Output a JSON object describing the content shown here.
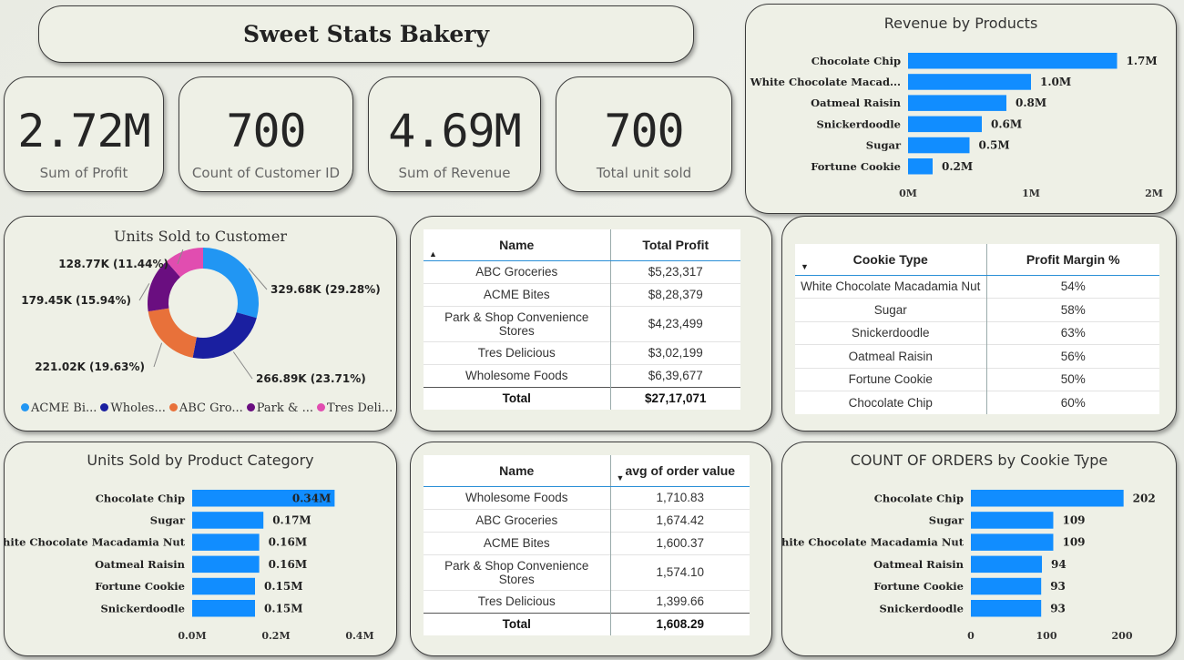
{
  "title": "Sweet Stats Bakery",
  "kpis": [
    {
      "value": "2.72M",
      "label": "Sum of Profit"
    },
    {
      "value": "700",
      "label": "Count of Customer ID"
    },
    {
      "value": "4.69M",
      "label": "Sum of Revenue"
    },
    {
      "value": "700",
      "label": "Total unit sold"
    }
  ],
  "colors": {
    "bar": "#118DFF",
    "donut": [
      "#2196F3",
      "#1A1FA0",
      "#E8713A",
      "#6A0E80",
      "#E14DB0"
    ]
  },
  "revenue_chart": {
    "title": "Revenue by Products",
    "chart_data": {
      "type": "bar",
      "categories": [
        "Chocolate Chip",
        "White Chocolate Macad...",
        "Oatmeal Raisin",
        "Snickerdoodle",
        "Sugar",
        "Fortune Cookie"
      ],
      "values": [
        1.7,
        1.0,
        0.8,
        0.6,
        0.5,
        0.2
      ],
      "data_labels": [
        "1.7M",
        "1.0M",
        "0.8M",
        "0.6M",
        "0.5M",
        "0.2M"
      ],
      "xlim": [
        0,
        2
      ],
      "ticks": [
        "0M",
        "1M",
        "2M"
      ]
    }
  },
  "donut_chart": {
    "title": "Units Sold to Customer",
    "chart_data": {
      "type": "pie",
      "categories": [
        "ACME Bites",
        "Wholesome Foods",
        "ABC Groceries",
        "Park & Shop Convenience Stores",
        "Tres Delicious"
      ],
      "values": [
        329.68,
        266.89,
        221.02,
        179.45,
        128.77
      ],
      "data_labels": [
        "329.68K (29.28%)",
        "266.89K (23.71%)",
        "221.02K (19.63%)",
        "179.45K (15.94%)",
        "128.77K (11.44%)"
      ],
      "legend": [
        "ACME Bi...",
        "Wholes...",
        "ABC Gro...",
        "Park & ...",
        "Tres Deli..."
      ]
    }
  },
  "profit_table": {
    "headers": [
      "Name",
      "Total Profit"
    ],
    "rows": [
      [
        "ABC Groceries",
        "$5,23,317"
      ],
      [
        "ACME Bites",
        "$8,28,379"
      ],
      [
        "Park & Shop Convenience Stores",
        "$4,23,499"
      ],
      [
        "Tres Delicious",
        "$3,02,199"
      ],
      [
        "Wholesome Foods",
        "$6,39,677"
      ]
    ],
    "total": [
      "Total",
      "$27,17,071"
    ]
  },
  "margin_table": {
    "headers": [
      "Cookie Type",
      "Profit Margin %"
    ],
    "rows": [
      [
        "White Chocolate Macadamia Nut",
        "54%"
      ],
      [
        "Sugar",
        "58%"
      ],
      [
        "Snickerdoodle",
        "63%"
      ],
      [
        "Oatmeal Raisin",
        "56%"
      ],
      [
        "Fortune Cookie",
        "50%"
      ],
      [
        "Chocolate Chip",
        "60%"
      ]
    ]
  },
  "category_chart": {
    "title": "Units Sold by Product Category",
    "chart_data": {
      "type": "bar",
      "categories": [
        "Chocolate Chip",
        "Sugar",
        "White Chocolate Macadamia Nut",
        "Oatmeal Raisin",
        "Fortune Cookie",
        "Snickerdoodle"
      ],
      "values": [
        0.34,
        0.17,
        0.16,
        0.16,
        0.15,
        0.15
      ],
      "data_labels": [
        "0.34M",
        "0.17M",
        "0.16M",
        "0.16M",
        "0.15M",
        "0.15M"
      ],
      "xlim": [
        0,
        0.4
      ],
      "ticks": [
        "0.0M",
        "0.2M",
        "0.4M"
      ]
    }
  },
  "order_table": {
    "headers": [
      "Name",
      "avg of order value"
    ],
    "rows": [
      [
        "Wholesome Foods",
        "1,710.83"
      ],
      [
        "ABC Groceries",
        "1,674.42"
      ],
      [
        "ACME Bites",
        "1,600.37"
      ],
      [
        "Park & Shop Convenience Stores",
        "1,574.10"
      ],
      [
        "Tres Delicious",
        "1,399.66"
      ]
    ],
    "total": [
      "Total",
      "1,608.29"
    ]
  },
  "orders_chart": {
    "title": "COUNT OF ORDERS by Cookie Type",
    "chart_data": {
      "type": "bar",
      "categories": [
        "Chocolate Chip",
        "Sugar",
        "White Chocolate Macadamia Nut",
        "Oatmeal Raisin",
        "Fortune Cookie",
        "Snickerdoodle"
      ],
      "values": [
        202,
        109,
        109,
        94,
        93,
        93
      ],
      "data_labels": [
        "202",
        "109",
        "109",
        "94",
        "93",
        "93"
      ],
      "xlim": [
        0,
        200
      ],
      "ticks": [
        "0",
        "100",
        "200"
      ]
    }
  }
}
